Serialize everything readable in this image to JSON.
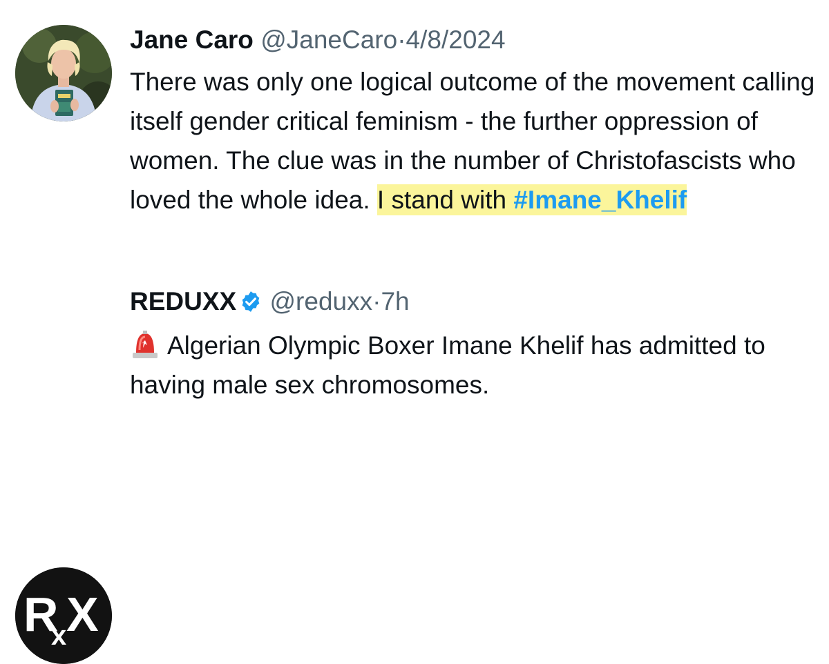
{
  "tweets": [
    {
      "author_name": "Jane Caro",
      "handle": "@JaneCaro",
      "separator": "·",
      "time": "4/8/2024",
      "text_plain": "There was only one logical outcome of the movement calling itself gender critical feminism - the further oppression of women. The clue was in the number of  Christofascists who loved the whole idea. ",
      "highlight_text": "I stand with ",
      "hashtag": "#Imane_Khelif",
      "avatar_icon": "person-photo-avatar"
    },
    {
      "author_name": "REDUXX",
      "verified_icon": "verified-badge-icon",
      "handle": "@reduxx",
      "separator": "·",
      "time": "7h",
      "emoji_icon": "siren-emoji",
      "text": "Algerian Olympic Boxer Imane Khelif has admitted to having male sex chromosomes.",
      "avatar_logo_text": "RxX"
    }
  ],
  "colors": {
    "highlight": "#fbf59b",
    "hashtag": "#1d9bf0",
    "verified": "#1d9bf0",
    "muted": "#536471"
  }
}
